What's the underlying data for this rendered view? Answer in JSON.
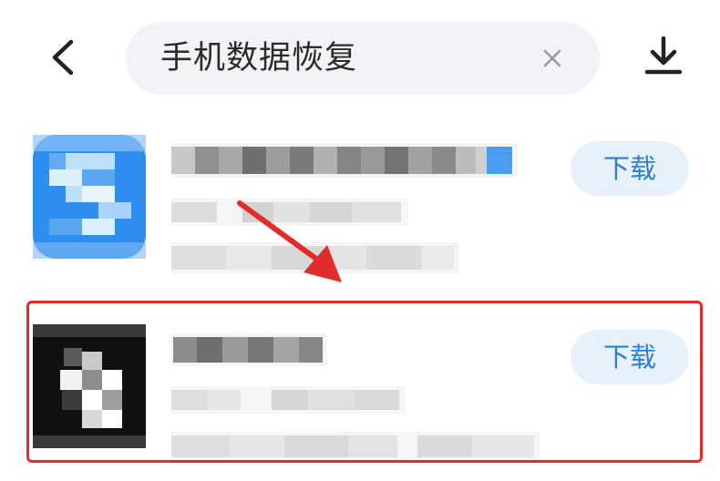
{
  "header": {
    "back_icon": "chevron-left-icon",
    "search_query": "手机数据恢复",
    "clear_icon": "close-icon",
    "download_icon": "download-icon"
  },
  "results": [
    {
      "icon_color": "#2e8ef0",
      "download_label": "下载"
    },
    {
      "icon_color": "#111111",
      "download_label": "下载"
    }
  ],
  "annotations": {
    "arrow_color": "#e42b2b",
    "highlight_color": "#e42b2b"
  }
}
